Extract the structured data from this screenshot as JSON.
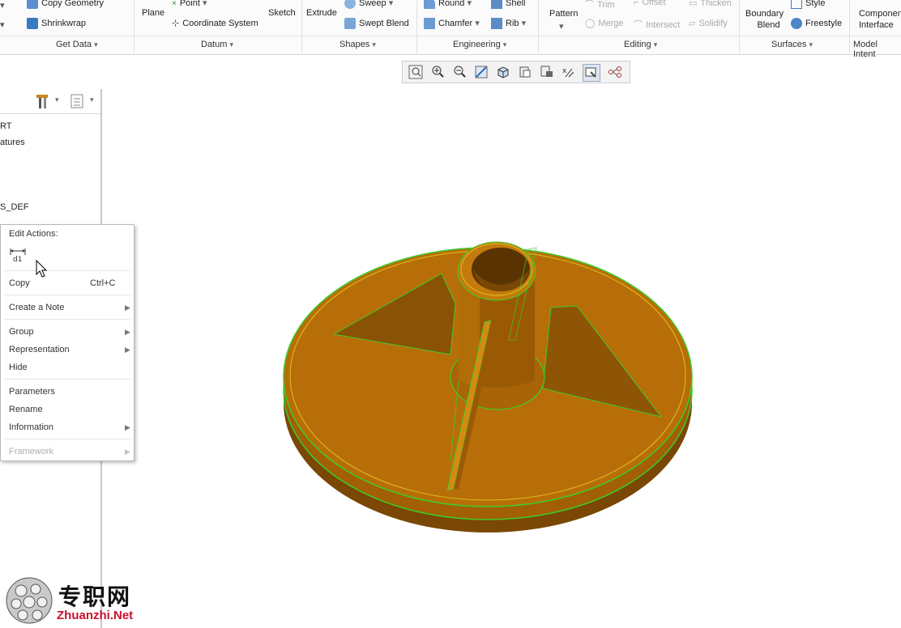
{
  "ribbon": {
    "copy_geometry": "Copy Geometry",
    "shrinkwrap": "Shrinkwrap",
    "plane": "Plane",
    "point": "Point",
    "coordinate_system": "Coordinate System",
    "sketch": "Sketch",
    "extrude": "Extrude",
    "sweep": "Sweep",
    "swept_blend": "Swept Blend",
    "round": "Round",
    "chamfer": "Chamfer",
    "shell": "Shell",
    "rib": "Rib",
    "pattern": "Pattern",
    "trim": "Trim",
    "merge": "Merge",
    "offset": "Offset",
    "intersect": "Intersect",
    "thicken": "Thicken",
    "solidify": "Solidify",
    "boundary_blend_1": "Boundary",
    "boundary_blend_2": "Blend",
    "style": "Style",
    "freestyle": "Freestyle",
    "component_interface_1": "Componen",
    "component_interface_2": "Interface",
    "groups": {
      "get_data": "Get Data",
      "datum": "Datum",
      "shapes": "Shapes",
      "engineering": "Engineering",
      "editing": "Editing",
      "surfaces": "Surfaces",
      "model_intent": "Model Intent"
    }
  },
  "tree": {
    "item1": "RT",
    "item2": "atures",
    "item3": "S_DEF"
  },
  "context_menu": {
    "header": "Edit Actions:",
    "copy": "Copy",
    "copy_shortcut": "Ctrl+C",
    "create_note": "Create a Note",
    "group": "Group",
    "representation": "Representation",
    "hide": "Hide",
    "parameters": "Parameters",
    "rename": "Rename",
    "information": "Information",
    "framework": "Framework"
  },
  "watermark": {
    "cn_text": "专职网",
    "url": "Zhuanzhi.Net"
  },
  "colors": {
    "part_fill": "#b86e08",
    "part_dark": "#8a5205",
    "edge_highlight": "#3ccc2c",
    "edge_yellow": "#e0c020",
    "watermark_red": "#c8102e"
  }
}
